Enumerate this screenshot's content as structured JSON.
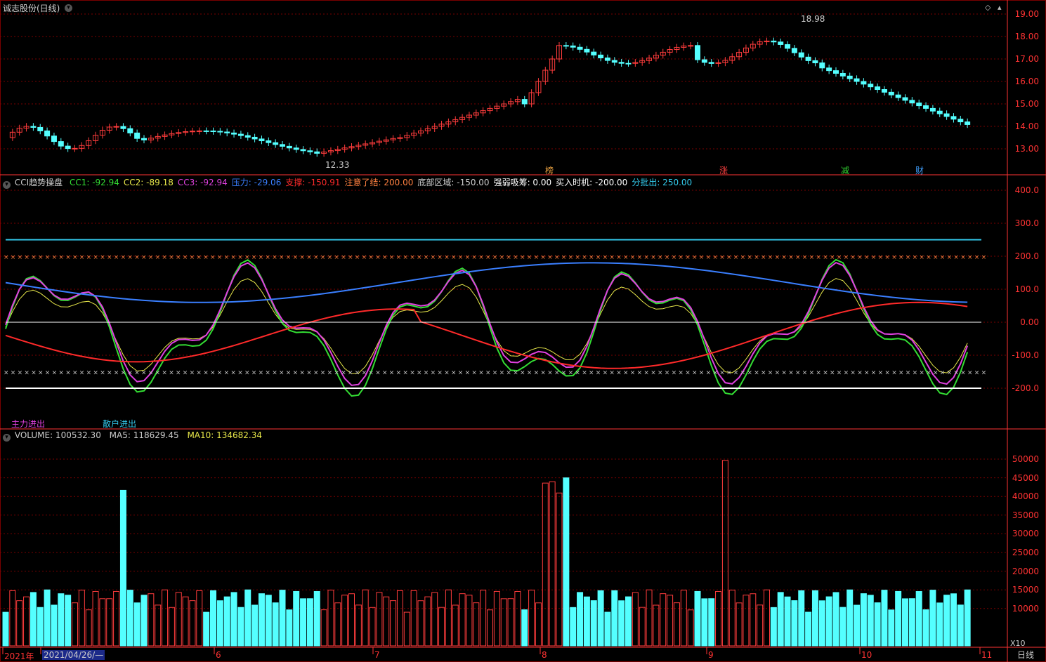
{
  "window": {
    "title": "诚志股份(日线)",
    "period": "日线",
    "scale": "X10"
  },
  "price_panel": {
    "y_ticks": [
      "19.00",
      "18.00",
      "17.00",
      "16.00",
      "15.00",
      "14.00",
      "13.00"
    ],
    "high_label": "18.98",
    "low_label": "12.33",
    "badges": [
      {
        "text": "榜",
        "color": "#e8a040"
      },
      {
        "text": "涨",
        "color": "#ff4040"
      },
      {
        "text": "减",
        "color": "#30d030"
      },
      {
        "text": "财",
        "color": "#40a0ff"
      }
    ]
  },
  "indicator_panel": {
    "name": "CCI趋势操盘",
    "params": [
      {
        "label": "CC1: -92.94",
        "color": "#33dd33"
      },
      {
        "label": "CC2: -89.18",
        "color": "#e8e84a"
      },
      {
        "label": "CC3: -92.94",
        "color": "#e040e0"
      },
      {
        "label": "压力: -29.06",
        "color": "#3a7fff"
      },
      {
        "label": "支撑: -150.91",
        "color": "#ff2a2a"
      },
      {
        "label": "注意了结: 200.00",
        "color": "#ff8040"
      },
      {
        "label": "底部区域: -150.00",
        "color": "#cccccc"
      },
      {
        "label": "强弱吸筹: 0.00",
        "color": "#ffffff"
      },
      {
        "label": "买入时机: -200.00",
        "color": "#ffffff"
      },
      {
        "label": "分批出: 250.00",
        "color": "#33ccee"
      }
    ],
    "y_ticks": [
      "400.0",
      "300.0",
      "200.0",
      "100.0",
      "0.00",
      "-100.0",
      "-200.0"
    ],
    "legend_main": "主力进出",
    "legend_retail": "散户进出"
  },
  "volume_panel": {
    "name": "VOLUME: 100532.30",
    "ma5": "MA5: 118629.45",
    "ma10": "MA10: 134682.34",
    "y_ticks": [
      "50000",
      "45000",
      "40000",
      "35000",
      "30000",
      "25000",
      "20000",
      "15000",
      "10000"
    ]
  },
  "date_axis": {
    "labels": [
      "2021年",
      "2021/04/26/—",
      "6",
      "7",
      "8",
      "9",
      "10",
      "11"
    ]
  },
  "colors": {
    "up": "#ff3c3c",
    "down": "#54ffff",
    "grid": "#7a0000",
    "axis": "#ff3333"
  }
}
